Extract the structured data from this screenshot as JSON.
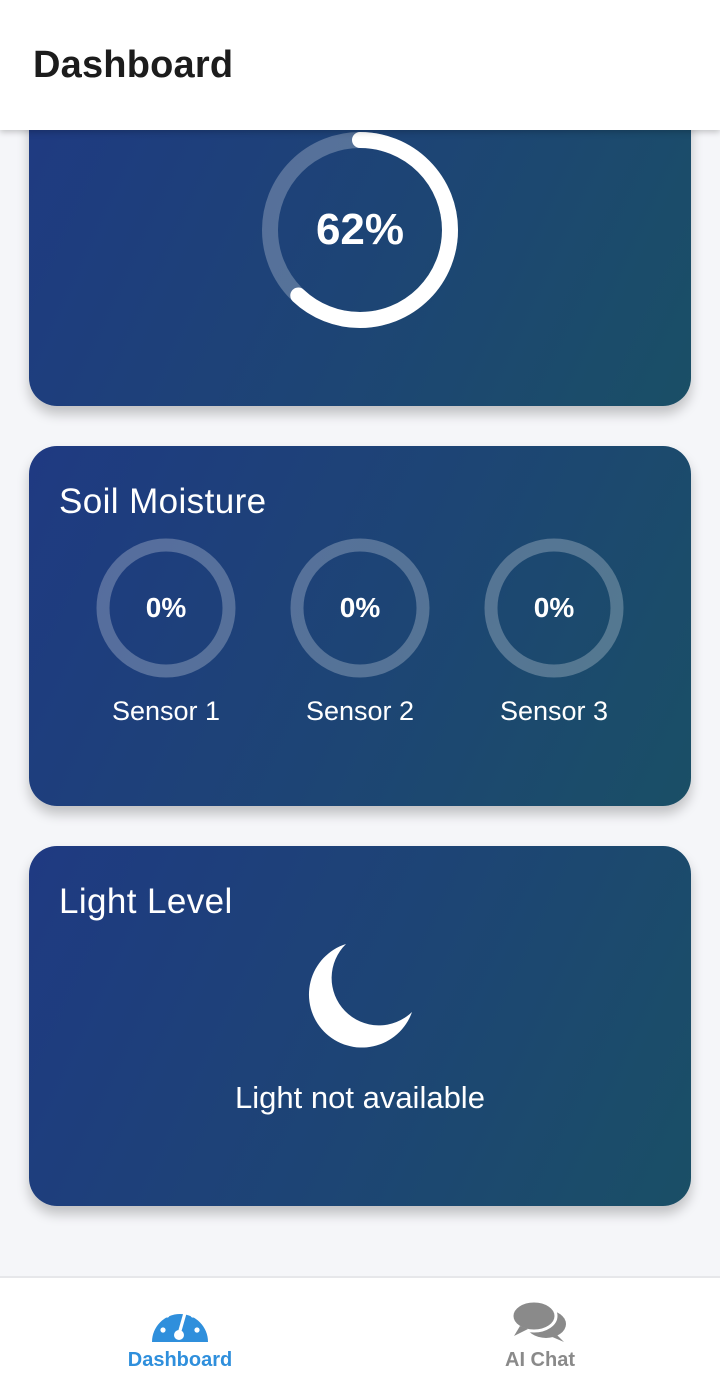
{
  "app_bar": {
    "title": "Dashboard"
  },
  "humidity_card": {
    "value_label": "62%",
    "progress": 0.62,
    "color": "#ffffff"
  },
  "soil_card": {
    "title": "Soil Moisture",
    "sensors": [
      {
        "label": "Sensor 1",
        "value_label": "0%",
        "progress": 0
      },
      {
        "label": "Sensor 2",
        "value_label": "0%",
        "progress": 0
      },
      {
        "label": "Sensor 3",
        "value_label": "0%",
        "progress": 0
      }
    ]
  },
  "light_card": {
    "title": "Light Level",
    "icon": "moon-icon",
    "status": "Light not available"
  },
  "bottom_nav": {
    "items": [
      {
        "label": "Dashboard",
        "icon": "dashboard-gauge-icon",
        "active": true,
        "color": "#2f8fdc"
      },
      {
        "label": "AI Chat",
        "icon": "chat-bubbles-icon",
        "active": false,
        "color": "#8a8a8a"
      }
    ]
  },
  "colors": {
    "card_gradient_start": "#1f3a82",
    "card_gradient_end": "#1a4f66",
    "accent": "#2f8fdc",
    "background": "#f5f6f9"
  }
}
